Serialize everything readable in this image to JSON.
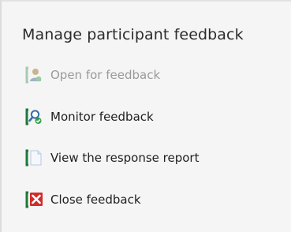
{
  "panel": {
    "title": "Manage participant feedback"
  },
  "menu": {
    "items": [
      {
        "label": "Open for feedback",
        "icon": "person-open-icon",
        "enabled": false
      },
      {
        "label": "Monitor feedback",
        "icon": "monitor-magnifier-icon",
        "enabled": true
      },
      {
        "label": "View the response report",
        "icon": "document-icon",
        "enabled": true
      },
      {
        "label": "Close feedback",
        "icon": "close-x-icon",
        "enabled": true
      }
    ]
  },
  "colors": {
    "bracket_green": "#1b7a3a",
    "close_red": "#d42b2b",
    "disabled_text": "#9a9a9a"
  }
}
